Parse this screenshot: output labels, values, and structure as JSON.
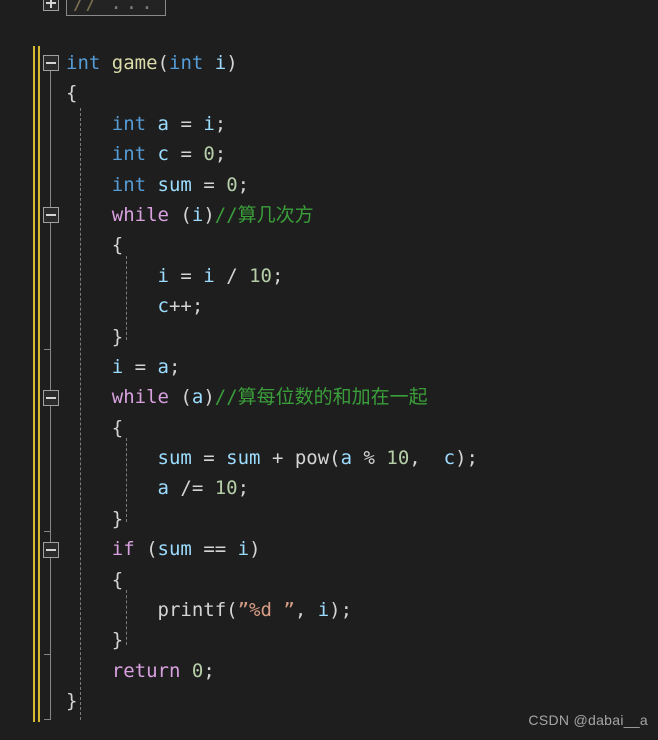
{
  "editor": {
    "background_color": "#1e1e1e",
    "change_bar_color": "#d7b82e",
    "fold_line_color": "#868686",
    "indent_guide_color": "#7a7a7a"
  },
  "collapsed_region": {
    "fold_icon": "expand-plus-icon",
    "slashes": "//",
    "dots": "...",
    "full_text": "// ..."
  },
  "fold_markers": [
    {
      "name": "fold-marker-function",
      "state": "expanded",
      "icon": "collapse-minus-icon"
    },
    {
      "name": "fold-marker-while-1",
      "state": "expanded",
      "icon": "collapse-minus-icon"
    },
    {
      "name": "fold-marker-while-2",
      "state": "expanded",
      "icon": "collapse-minus-icon"
    },
    {
      "name": "fold-marker-if",
      "state": "expanded",
      "icon": "collapse-minus-icon"
    }
  ],
  "code_lines": [
    {
      "id": "line-func-signature",
      "tokens": [
        {
          "text": "int",
          "cls": "t-type"
        },
        {
          "text": " ",
          "cls": "t-plain"
        },
        {
          "text": "game",
          "cls": "t-fn"
        },
        {
          "text": "(",
          "cls": "t-punct"
        },
        {
          "text": "int",
          "cls": "t-type"
        },
        {
          "text": " ",
          "cls": "t-plain"
        },
        {
          "text": "i",
          "cls": "t-var"
        },
        {
          "text": ")",
          "cls": "t-punct"
        }
      ]
    },
    {
      "id": "line-func-open-brace",
      "tokens": [
        {
          "text": "{",
          "cls": "t-brace"
        }
      ]
    },
    {
      "id": "line-decl-a",
      "tokens": [
        {
          "text": "    ",
          "cls": "t-plain"
        },
        {
          "text": "int",
          "cls": "t-type"
        },
        {
          "text": " ",
          "cls": "t-plain"
        },
        {
          "text": "a",
          "cls": "t-var"
        },
        {
          "text": " = ",
          "cls": "t-plain"
        },
        {
          "text": "i",
          "cls": "t-var"
        },
        {
          "text": ";",
          "cls": "t-punct"
        }
      ]
    },
    {
      "id": "line-decl-c",
      "tokens": [
        {
          "text": "    ",
          "cls": "t-plain"
        },
        {
          "text": "int",
          "cls": "t-type"
        },
        {
          "text": " ",
          "cls": "t-plain"
        },
        {
          "text": "c",
          "cls": "t-var"
        },
        {
          "text": " = ",
          "cls": "t-plain"
        },
        {
          "text": "0",
          "cls": "t-num"
        },
        {
          "text": ";",
          "cls": "t-punct"
        }
      ]
    },
    {
      "id": "line-decl-sum",
      "tokens": [
        {
          "text": "    ",
          "cls": "t-plain"
        },
        {
          "text": "int",
          "cls": "t-type"
        },
        {
          "text": " ",
          "cls": "t-plain"
        },
        {
          "text": "sum",
          "cls": "t-var"
        },
        {
          "text": " = ",
          "cls": "t-plain"
        },
        {
          "text": "0",
          "cls": "t-num"
        },
        {
          "text": ";",
          "cls": "t-punct"
        }
      ]
    },
    {
      "id": "line-while-i",
      "tokens": [
        {
          "text": "    ",
          "cls": "t-plain"
        },
        {
          "text": "while",
          "cls": "t-kw"
        },
        {
          "text": " (",
          "cls": "t-punct"
        },
        {
          "text": "i",
          "cls": "t-var"
        },
        {
          "text": ")",
          "cls": "t-punct"
        },
        {
          "text": "//算几次方",
          "cls": "t-cmt"
        }
      ]
    },
    {
      "id": "line-while-i-open",
      "tokens": [
        {
          "text": "    ",
          "cls": "t-plain"
        },
        {
          "text": "{",
          "cls": "t-brace"
        }
      ]
    },
    {
      "id": "line-i-div",
      "tokens": [
        {
          "text": "        ",
          "cls": "t-plain"
        },
        {
          "text": "i",
          "cls": "t-var"
        },
        {
          "text": " = ",
          "cls": "t-plain"
        },
        {
          "text": "i",
          "cls": "t-var"
        },
        {
          "text": " / ",
          "cls": "t-plain"
        },
        {
          "text": "10",
          "cls": "t-num"
        },
        {
          "text": ";",
          "cls": "t-punct"
        }
      ]
    },
    {
      "id": "line-c-inc",
      "tokens": [
        {
          "text": "        ",
          "cls": "t-plain"
        },
        {
          "text": "c",
          "cls": "t-var"
        },
        {
          "text": "++",
          "cls": "t-plain"
        },
        {
          "text": ";",
          "cls": "t-punct"
        }
      ]
    },
    {
      "id": "line-while-i-close",
      "tokens": [
        {
          "text": "    ",
          "cls": "t-plain"
        },
        {
          "text": "}",
          "cls": "t-brace"
        }
      ]
    },
    {
      "id": "line-i-assign-a",
      "tokens": [
        {
          "text": "    ",
          "cls": "t-plain"
        },
        {
          "text": "i",
          "cls": "t-var"
        },
        {
          "text": " = ",
          "cls": "t-plain"
        },
        {
          "text": "a",
          "cls": "t-var"
        },
        {
          "text": ";",
          "cls": "t-punct"
        }
      ]
    },
    {
      "id": "line-while-a",
      "tokens": [
        {
          "text": "    ",
          "cls": "t-plain"
        },
        {
          "text": "while",
          "cls": "t-kw"
        },
        {
          "text": " (",
          "cls": "t-punct"
        },
        {
          "text": "a",
          "cls": "t-var"
        },
        {
          "text": ")",
          "cls": "t-punct"
        },
        {
          "text": "//算每位数的和加在一起",
          "cls": "t-cmt"
        }
      ]
    },
    {
      "id": "line-while-a-open",
      "tokens": [
        {
          "text": "    ",
          "cls": "t-plain"
        },
        {
          "text": "{",
          "cls": "t-brace"
        }
      ]
    },
    {
      "id": "line-sum-pow",
      "tokens": [
        {
          "text": "        ",
          "cls": "t-plain"
        },
        {
          "text": "sum",
          "cls": "t-var"
        },
        {
          "text": " = ",
          "cls": "t-plain"
        },
        {
          "text": "sum",
          "cls": "t-var"
        },
        {
          "text": " + ",
          "cls": "t-plain"
        },
        {
          "text": "pow",
          "cls": "t-plain"
        },
        {
          "text": "(",
          "cls": "t-punct"
        },
        {
          "text": "a",
          "cls": "t-var"
        },
        {
          "text": " % ",
          "cls": "t-plain"
        },
        {
          "text": "10",
          "cls": "t-num"
        },
        {
          "text": ",  ",
          "cls": "t-punct"
        },
        {
          "text": "c",
          "cls": "t-var"
        },
        {
          "text": ")",
          "cls": "t-punct"
        },
        {
          "text": ";",
          "cls": "t-punct"
        }
      ]
    },
    {
      "id": "line-a-diveq",
      "tokens": [
        {
          "text": "        ",
          "cls": "t-plain"
        },
        {
          "text": "a",
          "cls": "t-var"
        },
        {
          "text": " /= ",
          "cls": "t-plain"
        },
        {
          "text": "10",
          "cls": "t-num"
        },
        {
          "text": ";",
          "cls": "t-punct"
        }
      ]
    },
    {
      "id": "line-while-a-close",
      "tokens": [
        {
          "text": "    ",
          "cls": "t-plain"
        },
        {
          "text": "}",
          "cls": "t-brace"
        }
      ]
    },
    {
      "id": "line-if-sum-eq-i",
      "tokens": [
        {
          "text": "    ",
          "cls": "t-plain"
        },
        {
          "text": "if",
          "cls": "t-kw"
        },
        {
          "text": " (",
          "cls": "t-punct"
        },
        {
          "text": "sum",
          "cls": "t-var"
        },
        {
          "text": " == ",
          "cls": "t-plain"
        },
        {
          "text": "i",
          "cls": "t-var"
        },
        {
          "text": ")",
          "cls": "t-punct"
        }
      ]
    },
    {
      "id": "line-if-open",
      "tokens": [
        {
          "text": "    ",
          "cls": "t-plain"
        },
        {
          "text": "{",
          "cls": "t-brace"
        }
      ]
    },
    {
      "id": "line-printf",
      "tokens": [
        {
          "text": "        ",
          "cls": "t-plain"
        },
        {
          "text": "printf",
          "cls": "t-plain"
        },
        {
          "text": "(",
          "cls": "t-punct"
        },
        {
          "text": "”%d ”",
          "cls": "t-str"
        },
        {
          "text": ", ",
          "cls": "t-punct"
        },
        {
          "text": "i",
          "cls": "t-var"
        },
        {
          "text": ")",
          "cls": "t-punct"
        },
        {
          "text": ";",
          "cls": "t-punct"
        }
      ]
    },
    {
      "id": "line-if-close",
      "tokens": [
        {
          "text": "    ",
          "cls": "t-plain"
        },
        {
          "text": "}",
          "cls": "t-brace"
        }
      ]
    },
    {
      "id": "line-return",
      "tokens": [
        {
          "text": "    ",
          "cls": "t-plain"
        },
        {
          "text": "return",
          "cls": "t-kw"
        },
        {
          "text": " ",
          "cls": "t-plain"
        },
        {
          "text": "0",
          "cls": "t-num"
        },
        {
          "text": ";",
          "cls": "t-punct"
        }
      ]
    },
    {
      "id": "line-func-close-brace",
      "tokens": [
        {
          "text": "}",
          "cls": "t-brace"
        }
      ]
    }
  ],
  "watermark": {
    "text": "CSDN @dabai__a"
  }
}
